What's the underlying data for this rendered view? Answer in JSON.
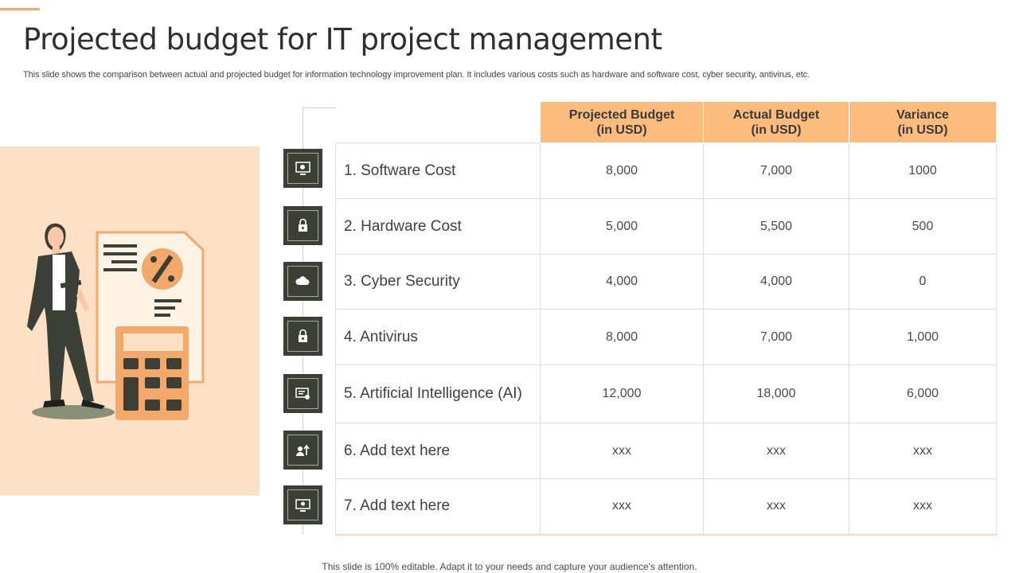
{
  "title": "Projected budget for IT project management",
  "subtitle": "This slide shows the comparison between actual and projected budget for information technology improvement plan. It includes various costs such as hardware and software cost, cyber security, antivirus, etc.",
  "table": {
    "headers": [
      {
        "line1": "Projected Budget",
        "line2": "(in USD)"
      },
      {
        "line1": "Actual Budget",
        "line2": "(in USD)"
      },
      {
        "line1": "Variance",
        "line2": "(in USD)"
      }
    ],
    "rows": [
      {
        "label": "1. Software Cost",
        "projected": "8,000",
        "actual": "7,000",
        "variance": "1000",
        "icon": "software-settings-icon"
      },
      {
        "label": "2. Hardware Cost",
        "projected": "5,000",
        "actual": "5,500",
        "variance": "500",
        "icon": "lock-icon"
      },
      {
        "label": "3. Cyber Security",
        "projected": "4,000",
        "actual": "4,000",
        "variance": "0",
        "icon": "cloud-security-icon"
      },
      {
        "label": "4. Antivirus",
        "projected": "8,000",
        "actual": "7,000",
        "variance": "1,000",
        "icon": "lock-icon"
      },
      {
        "label": "5. Artificial Intelligence (AI)",
        "projected": "12,000",
        "actual": "18,000",
        "variance": "6,000",
        "icon": "certificate-icon"
      },
      {
        "label": "6. Add text here",
        "projected": "xxx",
        "actual": "xxx",
        "variance": "xxx",
        "icon": "user-growth-icon"
      },
      {
        "label": "7. Add text here",
        "projected": "xxx",
        "actual": "xxx",
        "variance": "xxx",
        "icon": "monitor-idea-icon"
      }
    ]
  },
  "footer": "This slide is 100% editable. Adapt it to your needs and capture your audience's attention.",
  "colors": {
    "accent": "#fdbb7d",
    "illustration_bg": "#fde0c6",
    "icon_box": "#3c3f35"
  }
}
